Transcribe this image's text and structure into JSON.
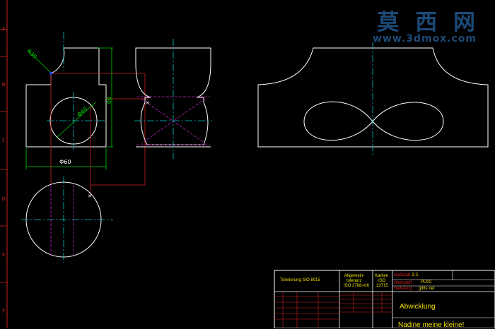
{
  "colors": {
    "background": "#000000",
    "outline": "#ffffff",
    "center_line": "#00c8c8",
    "hidden_line": "#c020c0",
    "dimension": "#00d000",
    "border": "#d02020",
    "title_text": "#f0e000",
    "watermark": "#1c4a78"
  },
  "watermark": {
    "title": "莫 西 网",
    "url": "www.3dmox.com"
  },
  "row_labels": [
    "A",
    "B",
    "C",
    "D",
    "E",
    "F"
  ],
  "dimensions": {
    "top_radius": "R30",
    "hole_diameter": "Φ40",
    "height": "80",
    "width": "Φ60"
  },
  "title_block": {
    "tolerance": "Tolerierung ISO 8015",
    "general_tolerance_1": "Allgemein-",
    "general_tolerance_2": "toleranz",
    "general_tolerance_3": "ISO 2768-mK",
    "edges_1": "Kanten",
    "edges_2": "ISO",
    "edges_3": "13715",
    "scale_label": "Maßstab",
    "scale_value": "1:1",
    "material_label": "Werkstoff",
    "material_value": "PU02",
    "weight_label": "Halbzeug",
    "weight_value": "gibts net",
    "drawing_title": "Abwicklung",
    "subtitle": "Nadine meine kleine!"
  }
}
